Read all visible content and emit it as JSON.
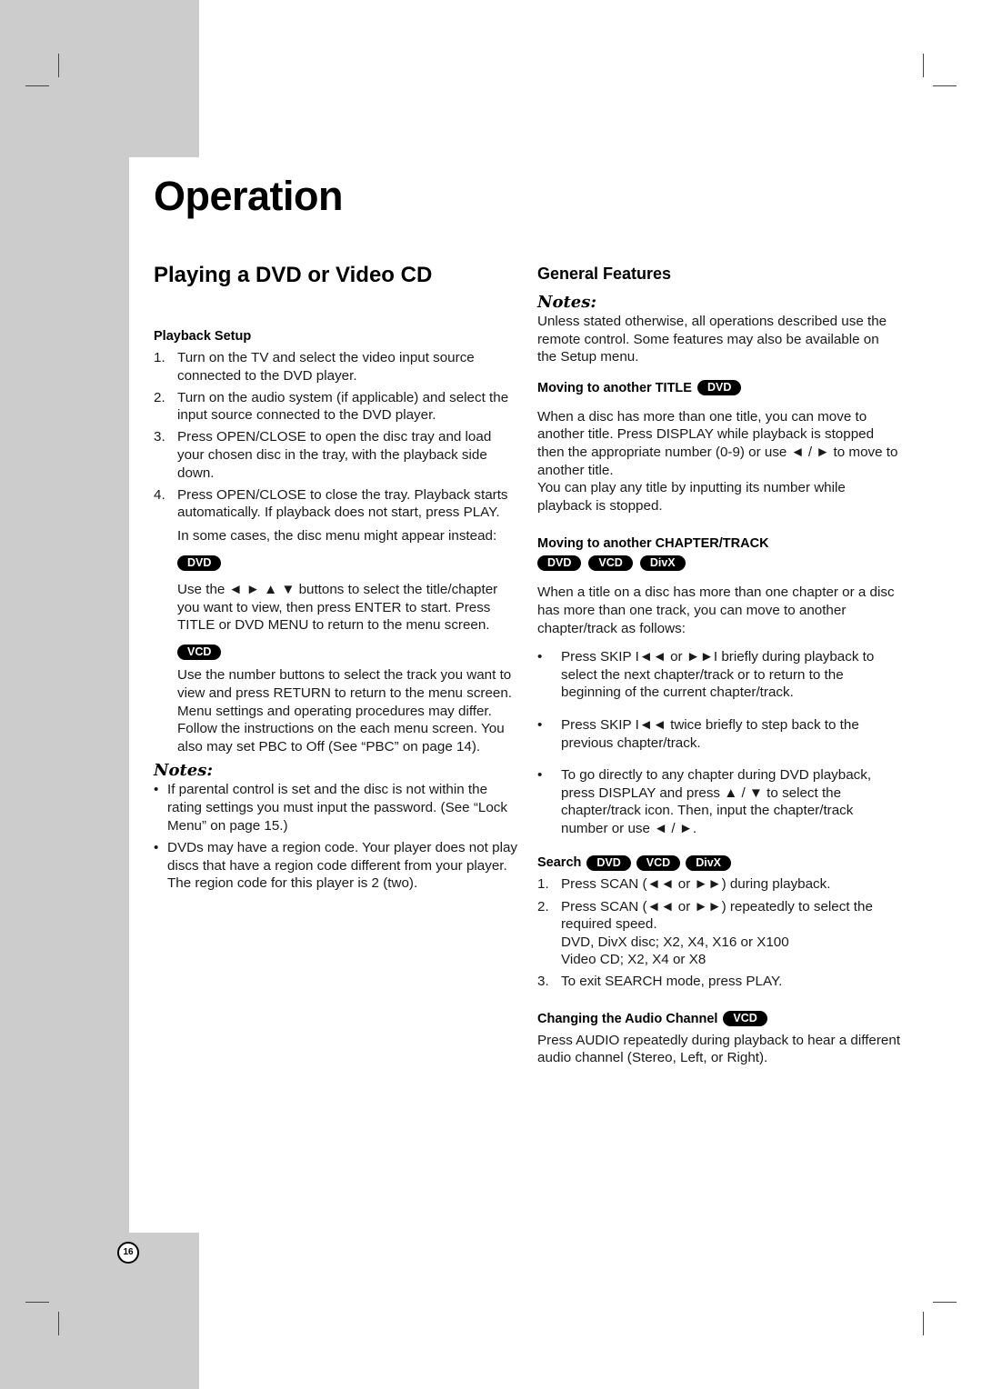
{
  "page": {
    "title": "Operation",
    "page_number": "16"
  },
  "left": {
    "heading": "Playing a DVD or Video CD",
    "playback_setup": {
      "heading": "Playback Setup",
      "steps": [
        {
          "num": "1.",
          "text": "Turn on the TV and select the video input source connected to the DVD player."
        },
        {
          "num": "2.",
          "text": "Turn on the audio system (if applicable) and select the input source connected to the DVD player."
        },
        {
          "num": "3.",
          "text": "Press OPEN/CLOSE to open the disc tray and load your chosen disc in the tray, with the playback side down."
        },
        {
          "num": "4.",
          "text": "Press OPEN/CLOSE to close the tray. Playback starts automatically. If playback does not start, press PLAY."
        }
      ],
      "disc_menu_note": "In some cases, the disc menu might appear instead:",
      "dvd_badge": "DVD",
      "dvd_text": "Use the ◄ ► ▲ ▼ buttons to select the title/chapter you want to view, then press ENTER to start. Press TITLE or DVD MENU to return to the menu screen.",
      "vcd_badge": "VCD",
      "vcd_text": "Use the number buttons to select the track you want to view and press RETURN to return to the menu screen. Menu settings and operating procedures may differ. Follow the instructions on the each menu screen. You also may set PBC to Off (See “PBC” on page 14)."
    },
    "notes": {
      "label": "Notes:",
      "items": [
        "If parental control is set and the disc is not within the rating settings you must input the password. (See “Lock Menu” on page 15.)",
        "DVDs may have a region code. Your player does not play discs that have a region code different from your player. The region code for this player is 2 (two)."
      ]
    }
  },
  "right": {
    "heading": "General Features",
    "notes_label": "Notes:",
    "notes_text": "Unless stated otherwise, all operations described use the remote control. Some features may also be available on the Setup menu.",
    "title_section": {
      "heading": "Moving to another TITLE",
      "badges": [
        "DVD"
      ],
      "text1": "When a disc has more than one title, you can move to another title. Press DISPLAY while playback is stopped then the appropriate number (0-9) or use ◄ / ► to move to another title.",
      "text2": "You can play any title by inputting its number while playback is stopped."
    },
    "chapter_section": {
      "heading": "Moving to another CHAPTER/TRACK",
      "badges": [
        "DVD",
        "VCD",
        "DivX"
      ],
      "intro": "When a title on a disc has more than one chapter or a disc has more than one track, you can move to another chapter/track as follows:",
      "bullets": [
        "Press SKIP I◄◄ or ►►I briefly during playback to select the next chapter/track or to return to the beginning of the current chapter/track.",
        "Press SKIP I◄◄ twice briefly to step back to the previous chapter/track.",
        "To go directly to any chapter during DVD playback, press DISPLAY and press ▲ / ▼ to select the chapter/track icon. Then, input the chapter/track number or use ◄ / ►."
      ]
    },
    "search_section": {
      "heading": "Search",
      "badges": [
        "DVD",
        "VCD",
        "DivX"
      ],
      "steps": [
        {
          "num": "1.",
          "text": "Press SCAN (◄◄ or ►►) during playback."
        },
        {
          "num": "2.",
          "text": "Press SCAN (◄◄ or ►►) repeatedly to select the required speed.",
          "extra": [
            "DVD, DivX disc; X2, X4, X16 or X100",
            "Video CD; X2, X4 or X8"
          ]
        },
        {
          "num": "3.",
          "text": "To exit SEARCH mode, press PLAY."
        }
      ]
    },
    "audio_section": {
      "heading": "Changing the Audio Channel",
      "badges": [
        "VCD"
      ],
      "text": "Press AUDIO repeatedly during playback to hear a different audio channel (Stereo, Left, or Right)."
    }
  }
}
